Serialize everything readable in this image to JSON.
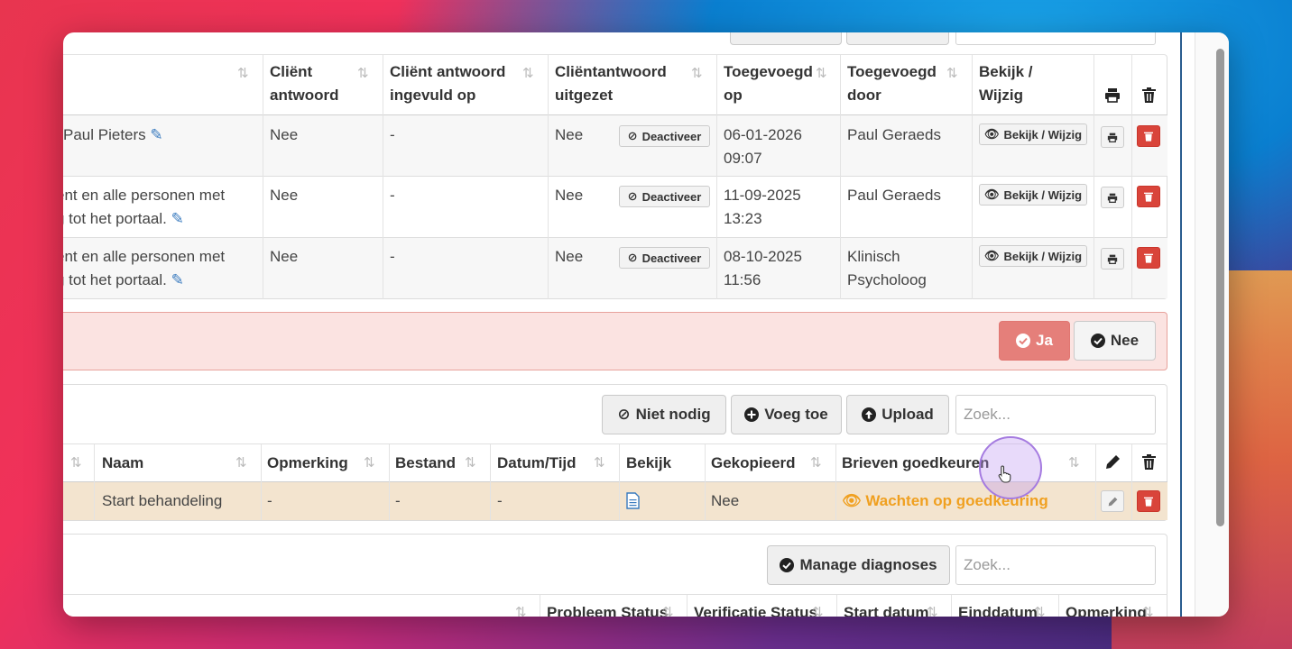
{
  "top_table": {
    "headers": {
      "client_answer": [
        "Cliënt",
        "antwoord"
      ],
      "answer_filled_on": [
        "Cliënt antwoord",
        "ingevuld op"
      ],
      "answer_disabled": [
        "Cliëntantwoord",
        "uitgezet"
      ],
      "added_on": [
        "Toegevoegd",
        "op"
      ],
      "added_by": [
        "Toegevoegd",
        "door"
      ],
      "view_edit": [
        "Bekijk /",
        "Wijzig"
      ]
    },
    "rows": [
      {
        "recipient": [
          "Paul Pieters"
        ],
        "client_answer": "Nee",
        "filled_on": "-",
        "disabled": "Nee",
        "deactivate_label": "Deactiveer",
        "added_on": [
          "06-01-2026",
          "09:07"
        ],
        "added_by": [
          "Paul Geraeds"
        ],
        "view_label": "Bekijk / Wijzig"
      },
      {
        "recipient": [
          "ënt en alle personen met",
          "g tot het portaal."
        ],
        "client_answer": "Nee",
        "filled_on": "-",
        "disabled": "Nee",
        "deactivate_label": "Deactiveer",
        "added_on": [
          "11-09-2025",
          "13:23"
        ],
        "added_by": [
          "Paul Geraeds"
        ],
        "view_label": "Bekijk / Wijzig"
      },
      {
        "recipient": [
          "ënt en alle personen met",
          "g tot het portaal."
        ],
        "client_answer": "Nee",
        "filled_on": "-",
        "disabled": "Nee",
        "deactivate_label": "Deactiveer",
        "added_on": [
          "08-10-2025",
          "11:56"
        ],
        "added_by": [
          "Klinisch",
          "Psycholoog"
        ],
        "view_label": "Bekijk / Wijzig"
      }
    ]
  },
  "confirm_bar": {
    "yes_label": "Ja",
    "no_label": "Nee"
  },
  "docs_panel": {
    "not_needed_label": "Niet nodig",
    "add_label": "Voeg toe",
    "upload_label": "Upload",
    "search_placeholder": "Zoek...",
    "headers": {
      "name": "Naam",
      "remark": "Opmerking",
      "file": "Bestand",
      "datetime": "Datum/Tijd",
      "view": "Bekijk",
      "copied": "Gekopieerd",
      "letters_approve": "Brieven goedkeuren"
    },
    "row": {
      "name": "Start behandeling",
      "remark": "-",
      "file": "-",
      "datetime": "-",
      "copied": "Nee",
      "status": "Wachten op goedkeuring"
    }
  },
  "diag_panel": {
    "manage_label": "Manage diagnoses",
    "search_placeholder": "Zoek...",
    "headers": {
      "problem_status": "Probleem Status",
      "verification_status": "Verificatie Status",
      "start_date": "Start datum",
      "end_date": "Einddatum",
      "remark": "Opmerking"
    }
  },
  "colors": {
    "danger": "#d9443a",
    "danger_light": "#e57f7a",
    "warning": "#f0a020",
    "highlight_row": "#f3e4cf",
    "accent_border": "#2a5d8f"
  }
}
